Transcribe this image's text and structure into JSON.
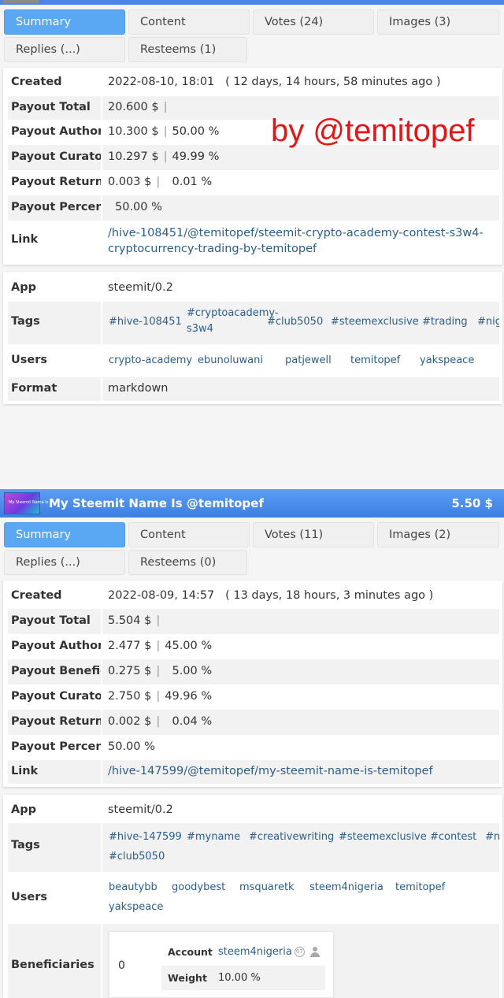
{
  "watermark": "by @temitopef",
  "post1": {
    "tabs": [
      "Summary",
      "Content",
      "Votes (24)",
      "Images (3)",
      "Replies (...)",
      "Resteems (1)"
    ],
    "rows": {
      "created_label": "Created",
      "created_value": "2022-08-10, 18:01",
      "created_ago": "( 12 days, 14 hours, 58 minutes ago )",
      "total_label": "Payout Total",
      "total_value": "20.600 $",
      "author_label": "Payout Author",
      "author_value": "10.300 $",
      "author_pct": "50.00 %",
      "curators_label": "Payout Curators",
      "curators_value": "10.297 $",
      "curators_pct": "49.99 %",
      "returned_label": "Payout Returned",
      "returned_value": "0.003 $",
      "returned_pct": "0.01 %",
      "percent_label": "Payout Percent S",
      "percent_value": "50.00 %",
      "link_label": "Link",
      "link_line1": "/hive-108451/@temitopef/steemit-crypto-academy-contest-s3w4-",
      "link_line2": "cryptocurrency-trading-by-temitopef"
    },
    "meta": {
      "app_label": "App",
      "app_value": "steemit/0.2",
      "tags_label": "Tags",
      "tags": [
        "#hive-108451",
        "#cryptoacademy-",
        "s3w4",
        "#club5050",
        "#steemexclusive",
        "#trading",
        "#nige"
      ],
      "users_label": "Users",
      "users": [
        "crypto-academy",
        "ebunoluwani",
        "patjewell",
        "temitopef",
        "yakspeace"
      ],
      "format_label": "Format",
      "format_value": "markdown"
    }
  },
  "post2": {
    "header": {
      "title": "My Steemit Name Is @temitopef",
      "amount": "5.50 $",
      "thumb_text": "My Steemit Name Is"
    },
    "tabs": [
      "Summary",
      "Content",
      "Votes (11)",
      "Images (2)",
      "Replies (...)",
      "Resteems (0)"
    ],
    "rows": {
      "created_label": "Created",
      "created_value": "2022-08-09, 14:57",
      "created_ago": "( 13 days, 18 hours, 3 minutes ago )",
      "total_label": "Payout Total",
      "total_value": "5.504 $",
      "author_label": "Payout Author",
      "author_value": "2.477 $",
      "author_pct": "45.00 %",
      "benef_label": "Payout Beneficia",
      "benef_value": "0.275 $",
      "benef_pct": "5.00 %",
      "curators_label": "Payout Curators",
      "curators_value": "2.750 $",
      "curators_pct": "49.96 %",
      "returned_label": "Payout Returned",
      "returned_value": "0.002 $",
      "returned_pct": "0.04 %",
      "percent_label": "Payout Percent S",
      "percent_value": "50.00 %",
      "link_label": "Link",
      "link_value": "/hive-147599/@temitopef/my-steemit-name-is-temitopef"
    },
    "meta": {
      "app_label": "App",
      "app_value": "steemit/0.2",
      "tags_label": "Tags",
      "tags": [
        "#hive-147599",
        "#myname",
        "#creativewriting",
        "#steemexclusive",
        "#contest",
        "#ni",
        "#club5050"
      ],
      "users_label": "Users",
      "users": [
        "beautybb",
        "goodybest",
        "msquaretk",
        "steem4nigeria",
        "temitopef",
        "yakspeace"
      ],
      "beneficiaries_label": "Beneficiaries",
      "beneficiaries_count": "0",
      "benef_table": {
        "account_label": "Account",
        "account_value": "steem4nigeria",
        "account_rep": "67",
        "weight_label": "Weight",
        "weight_value": "10.00 %"
      }
    }
  },
  "pipe": "|"
}
